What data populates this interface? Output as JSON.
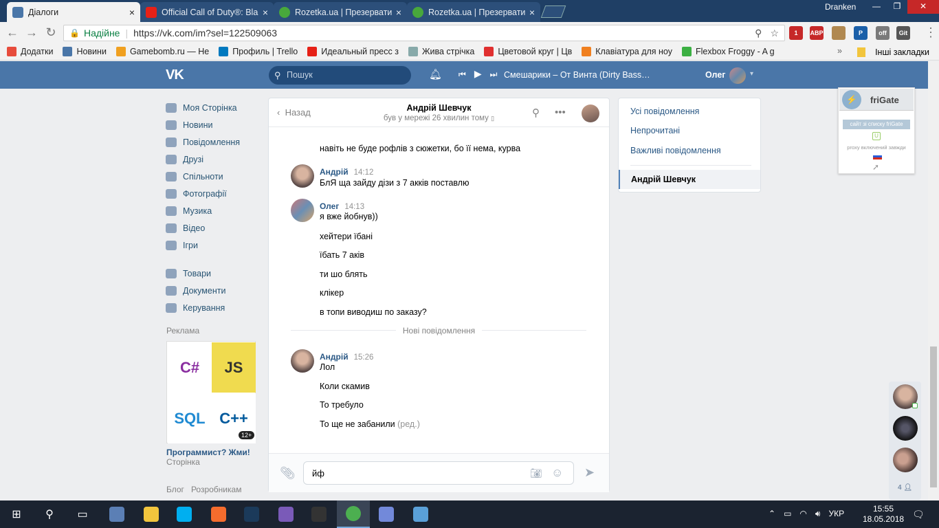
{
  "browser": {
    "tabs": [
      {
        "title": "Діалоги",
        "icon": "vk-icon",
        "color": "#4a76a8",
        "active": true
      },
      {
        "title": "Official Call of Duty®: Bla",
        "icon": "youtube-icon",
        "color": "#e62117"
      },
      {
        "title": "Rozetka.ua | Презервати",
        "icon": "rozetka-icon",
        "color": "#48a83c"
      },
      {
        "title": "Rozetka.ua | Презервати",
        "icon": "rozetka-icon",
        "color": "#48a83c"
      }
    ],
    "close_glyph": "×",
    "os_user": "Dranken",
    "window_controls": [
      "—",
      "❐",
      "✕"
    ],
    "address": {
      "secure_label": "Надійне",
      "url": "https://vk.com/im?sel=122509063"
    },
    "extensions": [
      {
        "name": "adblock-icon",
        "label": "1",
        "color": "#c62828"
      },
      {
        "name": "abp-icon",
        "label": "ABP",
        "color": "#c62828"
      },
      {
        "name": "face-icon",
        "label": "",
        "color": "#b08850"
      },
      {
        "name": "p-icon",
        "label": "P",
        "color": "#1a5fa8"
      },
      {
        "name": "gear-ext-icon",
        "label": "off",
        "color": "#7a7a7a"
      },
      {
        "name": "gitzip-icon",
        "label": "Git Zip",
        "color": "#555"
      }
    ],
    "bookmarks": [
      {
        "label": "Додатки",
        "color": "#e74c3c"
      },
      {
        "label": "Новини",
        "color": "#4a76a8"
      },
      {
        "label": "Gamebomb.ru — Не",
        "color": "#f0a020"
      },
      {
        "label": "Профиль | Trello",
        "color": "#0079bf"
      },
      {
        "label": "Идеальный пресс з",
        "color": "#e62117"
      },
      {
        "label": "Жива стрічка",
        "color": "#8aa"
      },
      {
        "label": "Цветовой круг | Цв",
        "color": "#e03030"
      },
      {
        "label": "Клавіатура для ноу",
        "color": "#f08020"
      },
      {
        "label": "Flexbox Froggy - A g",
        "color": "#3cb043"
      }
    ],
    "other_bookmarks": "Інші закладки"
  },
  "vk_header": {
    "logo": "VK",
    "search_placeholder": "Пошук",
    "track": "Смешарики – От Винта (Dirty Bass…",
    "user": "Олег"
  },
  "left_menu": {
    "group1": [
      {
        "label": "Моя Сторінка",
        "icon": "home-icon"
      },
      {
        "label": "Новини",
        "icon": "news-icon"
      },
      {
        "label": "Повідомлення",
        "icon": "messages-icon"
      },
      {
        "label": "Друзі",
        "icon": "friends-icon"
      },
      {
        "label": "Спільноти",
        "icon": "groups-icon"
      },
      {
        "label": "Фотографії",
        "icon": "camera-icon"
      },
      {
        "label": "Музика",
        "icon": "music-icon"
      },
      {
        "label": "Відео",
        "icon": "video-icon"
      },
      {
        "label": "Ігри",
        "icon": "games-icon"
      }
    ],
    "group2": [
      {
        "label": "Товари",
        "icon": "goods-icon"
      },
      {
        "label": "Документи",
        "icon": "docs-icon"
      },
      {
        "label": "Керування",
        "icon": "manage-icon"
      }
    ],
    "ad_label": "Реклама",
    "ad_tiles": [
      "C#",
      "JS",
      "SQL",
      "C++"
    ],
    "ad_age": "12+",
    "ad_title": "Программист? Жми!",
    "ad_sub": "Сторінка",
    "footer": [
      "Блог",
      "Розробникам"
    ]
  },
  "chat": {
    "back_label": "Назад",
    "name": "Андрій Шевчук",
    "status": "був у мережі 26 хвилин тому",
    "groups": [
      {
        "author": "",
        "time": "",
        "avatar": "",
        "messages": [
          "навіть не буде рофлів з сюжетки, бо її нема, курва"
        ]
      },
      {
        "author": "Андрій",
        "time": "14:12",
        "avatar": "a",
        "messages": [
          "БлЯ ща зайду дізи з 7 акків поставлю"
        ]
      },
      {
        "author": "Олег",
        "time": "14:13",
        "avatar": "o",
        "messages": [
          "я вже йобнув))",
          "хейтери їбані",
          "їбать 7 аків",
          "ти шо блять",
          "клікер",
          "в топи виводиш по заказу?"
        ]
      },
      {
        "author": "Андрій",
        "time": "15:26",
        "avatar": "a",
        "messages": [
          "Лол",
          "Коли скамив",
          "То требуло",
          "То ще не забанили"
        ]
      }
    ],
    "edited_label": "(ред.)",
    "new_messages_label": "Нові повідомлення",
    "input_value": "йф"
  },
  "right_panel": {
    "items": [
      "Усі повідомлення",
      "Непрочитані",
      "Важливі повідомлення"
    ],
    "active": "Андрій Шевчук"
  },
  "frigate": {
    "name": "friGate",
    "button": "сайт зі списку friGate",
    "proxy": "proxy включений завжди"
  },
  "chat_bubbles": {
    "count": "4"
  },
  "taskbar": {
    "apps": [
      {
        "name": "start-icon",
        "color": "#ffffff"
      },
      {
        "name": "search-icon",
        "color": "#ffffff"
      },
      {
        "name": "taskview-icon",
        "color": "#ffffff"
      },
      {
        "name": "app-icon",
        "color": "#5b7fb5"
      },
      {
        "name": "explorer-icon",
        "color": "#f2c53d"
      },
      {
        "name": "skype-icon",
        "color": "#00aff0"
      },
      {
        "name": "origin-icon",
        "color": "#f56c2d"
      },
      {
        "name": "steam-icon",
        "color": "#1b3a5a"
      },
      {
        "name": "app2-icon",
        "color": "#7a5ab8"
      },
      {
        "name": "intellij-icon",
        "color": "#333333"
      },
      {
        "name": "chrome-icon",
        "color": "#4caf50"
      },
      {
        "name": "discord-icon",
        "color": "#7289da"
      },
      {
        "name": "app3-icon",
        "color": "#5aa0d8"
      }
    ],
    "language": "УКР",
    "time": "15:55",
    "date": "18.05.2018"
  }
}
